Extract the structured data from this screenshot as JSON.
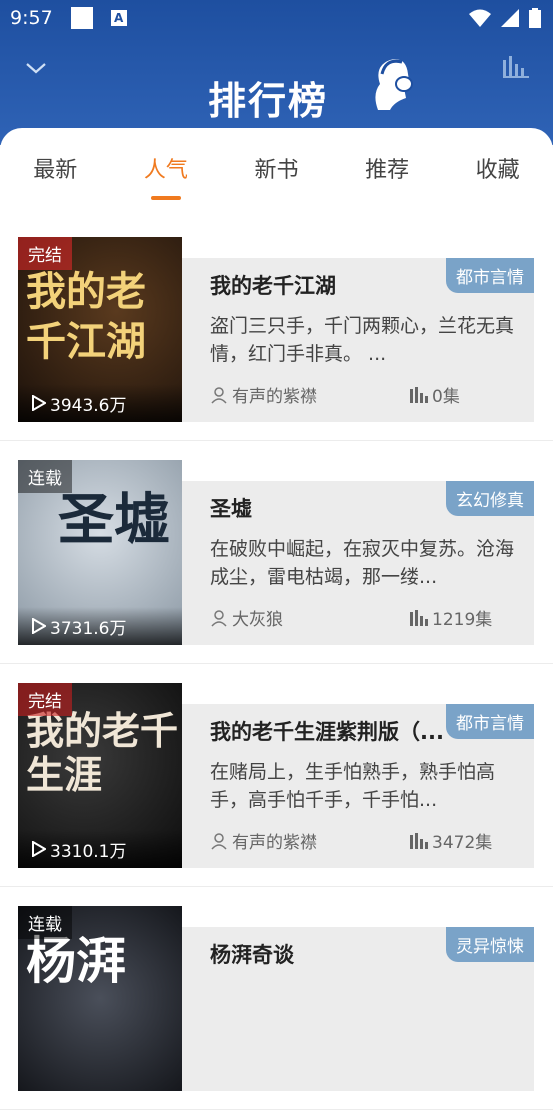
{
  "status_bar": {
    "time": "9:57"
  },
  "header": {
    "title": "排行榜"
  },
  "tabs": [
    {
      "label": "最新"
    },
    {
      "label": "人气"
    },
    {
      "label": "新书"
    },
    {
      "label": "推荐"
    },
    {
      "label": "收藏"
    }
  ],
  "active_tab": "人气",
  "books": [
    {
      "status": "完结",
      "plays": "3943.6万",
      "title": "我的老千江湖",
      "genre": "都市言情",
      "desc": "盗门三只手，千门两颗心，兰花无真情，红门手非真。 ...",
      "author": "有声的紫襟",
      "episodes": "0集",
      "cover_text": "我的老千江湖"
    },
    {
      "status": "连载",
      "plays": "3731.6万",
      "title": "圣墟",
      "genre": "玄幻修真",
      "desc": "在破败中崛起，在寂灭中复苏。沧海成尘，雷电枯竭，那一缕...",
      "author": "大灰狼",
      "episodes": "1219集",
      "cover_text": "圣墟"
    },
    {
      "status": "完结",
      "plays": "3310.1万",
      "title": "我的老千生涯紫荆版（...",
      "genre": "都市言情",
      "desc": "在赌局上，生手怕熟手，熟手怕高手，高手怕千手，千手怕...",
      "author": "有声的紫襟",
      "episodes": "3472集",
      "cover_text": "我的老千生涯"
    },
    {
      "status": "连载",
      "plays": "",
      "title": "杨湃奇谈",
      "genre": "灵异惊悚",
      "desc": "",
      "author": "",
      "episodes": "",
      "cover_text": "杨湃"
    }
  ]
}
